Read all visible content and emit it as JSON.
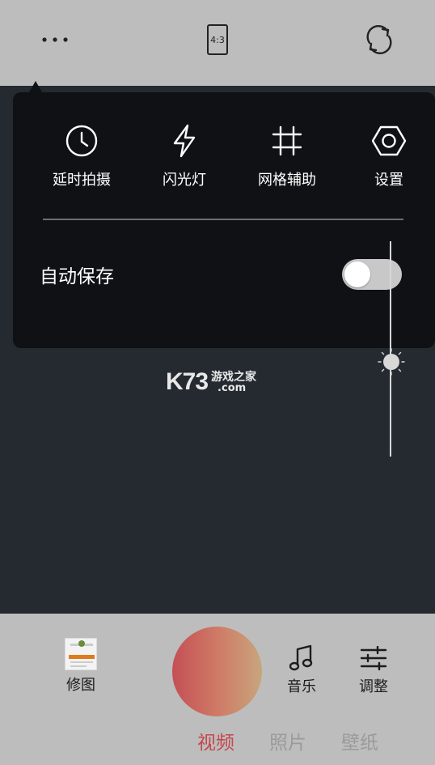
{
  "topbar": {
    "more_icon": "more-dots-icon",
    "ratio_label": "4:3",
    "switch_icon": "camera-switch-icon"
  },
  "settings_panel": {
    "options": [
      {
        "label": "延时拍摄",
        "icon": "clock-icon"
      },
      {
        "label": "闪光灯",
        "icon": "flash-icon"
      },
      {
        "label": "网格辅助",
        "icon": "grid-icon"
      },
      {
        "label": "设置",
        "icon": "settings-hexagon-icon"
      }
    ],
    "autosave_label": "自动保存",
    "autosave_on": false
  },
  "exposure_slider": {
    "level": 0.44
  },
  "watermark": {
    "brand": "K73",
    "text_cn": "游戏之家",
    "domain": ".com"
  },
  "bottombar": {
    "edit_label": "修图",
    "music_label": "音乐",
    "adjust_label": "调整",
    "modes": [
      "视频",
      "照片",
      "壁纸"
    ],
    "active_mode": "视频"
  },
  "colors": {
    "bar_bg": "#bdbdbd",
    "viewfinder_bg": "#252a31",
    "panel_bg": "#0f1114",
    "active_mode": "#c4484f",
    "inactive_mode": "#9a9a9a"
  }
}
